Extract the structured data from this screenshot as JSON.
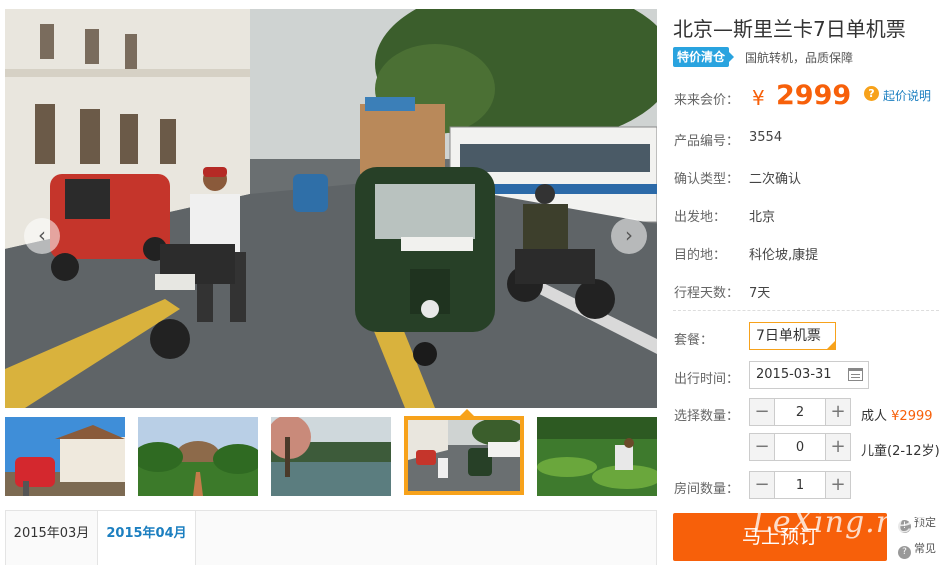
{
  "gallery": {
    "prev_arrow": "‹",
    "next_arrow": "›",
    "main_image_desc": "Kandy street with tuk-tuks, motorbikes and a bus",
    "thumbnails": [
      {
        "desc": "Temple of the Tooth with decorated elephant"
      },
      {
        "desc": "Sigiriya rock above green gardens"
      },
      {
        "desc": "Kandy lake with flowering tree"
      },
      {
        "desc": "Kandy street with tuk-tuks",
        "active": true
      },
      {
        "desc": "Tea plantation workers"
      }
    ]
  },
  "calendar": {
    "tabs": [
      {
        "label": "2015年03月"
      },
      {
        "label": "2015年04月",
        "active": true
      }
    ]
  },
  "product": {
    "title": "北京—斯里兰卡7日单机票",
    "promo_badge": "特价清仓",
    "promo_text": "国航转机，品质保障",
    "price_label": "来来会价：",
    "currency": "¥",
    "price": "2999",
    "help_icon": "?",
    "price_help_link": "起价说明",
    "fields": [
      {
        "label": "产品编号：",
        "value": "3554"
      },
      {
        "label": "确认类型：",
        "value": "二次确认"
      },
      {
        "label": "出发地：",
        "value": "北京"
      },
      {
        "label": "目的地：",
        "value": "科伦坡,康提"
      },
      {
        "label": "行程天数：",
        "value": "7天"
      }
    ]
  },
  "booking": {
    "package_label": "套餐：",
    "package_option": "7日单机票",
    "date_label": "出行时间：",
    "date_value": "2015-03-31",
    "qty_label": "选择数量：",
    "minus": "−",
    "plus": "+",
    "adult_qty": "2",
    "adult_label": "成人",
    "adult_price": "¥2999",
    "child_qty": "0",
    "child_label": "儿童(2-12岁)",
    "rooms_label": "房间数量：",
    "rooms_qty": "1",
    "book_button": "马上预订"
  },
  "side_notes": [
    {
      "icon": "!",
      "text": "预定"
    },
    {
      "icon": "?",
      "text": "常见"
    }
  ],
  "watermark": "LeXing.net",
  "colors": {
    "accent_orange": "#f7600a",
    "highlight": "#f7a21b",
    "link_blue": "#1c7fc0",
    "badge_blue": "#29a3df"
  }
}
